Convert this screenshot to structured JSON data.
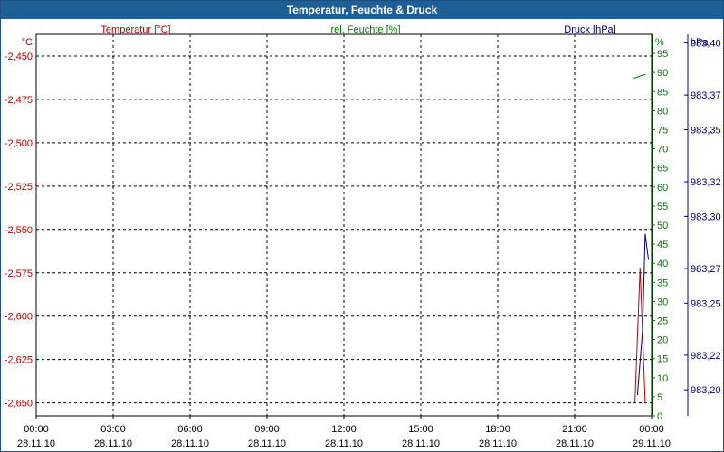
{
  "window": {
    "title": "Temperatur, Feuchte & Druck"
  },
  "chart_data": {
    "type": "line",
    "title": "Temperatur, Feuchte & Druck",
    "grid": true,
    "x_ticks": [
      {
        "time": "00:00",
        "date": "28.11.10"
      },
      {
        "time": "03:00",
        "date": "28.11.10"
      },
      {
        "time": "06:00",
        "date": "28.11.10"
      },
      {
        "time": "09:00",
        "date": "28.11.10"
      },
      {
        "time": "12:00",
        "date": "28.11.10"
      },
      {
        "time": "15:00",
        "date": "28.11.10"
      },
      {
        "time": "18:00",
        "date": "28.11.10"
      },
      {
        "time": "21:00",
        "date": "28.11.10"
      },
      {
        "time": "00:00",
        "date": "29.11.10"
      }
    ],
    "x_range_hours": [
      0,
      24
    ],
    "axes": {
      "temperature": {
        "label": "Temperatur [°C]",
        "unit": "°C",
        "color": "#c00000",
        "range": [
          -2.6575,
          -2.4375
        ],
        "ticks": [
          "-2,450",
          "-2,475",
          "-2,500",
          "-2,525",
          "-2,550",
          "-2,575",
          "-2,600",
          "-2,625",
          "-2,650"
        ]
      },
      "humidity": {
        "label": "rel. Feuchte [%]",
        "unit": "%",
        "color": "#007a00",
        "range": [
          0,
          100
        ],
        "ticks": [
          "0",
          "5",
          "10",
          "15",
          "20",
          "25",
          "30",
          "35",
          "40",
          "45",
          "50",
          "55",
          "60",
          "65",
          "70",
          "75",
          "80",
          "85",
          "90",
          "95"
        ]
      },
      "pressure": {
        "label": "Druck [hPa]",
        "unit": "hPa",
        "color": "#00007a",
        "range": [
          983.185,
          983.405
        ],
        "ticks": [
          "983,40",
          "983,37",
          "983,35",
          "983,32",
          "983,30",
          "983,27",
          "983,25",
          "983,22",
          "983,20"
        ]
      }
    },
    "series": [
      {
        "axis": "temperature",
        "color": "#c00000",
        "points": [
          [
            23.35,
            -2.65
          ],
          [
            23.55,
            -2.572
          ],
          [
            23.75,
            -2.65
          ]
        ]
      },
      {
        "axis": "humidity",
        "color": "#007a00",
        "points": [
          [
            23.3,
            88.5
          ],
          [
            23.75,
            89.5
          ]
        ]
      },
      {
        "axis": "pressure",
        "color": "#00007a",
        "points": [
          [
            23.45,
            983.197
          ],
          [
            23.65,
            983.235
          ],
          [
            23.75,
            983.29
          ],
          [
            23.88,
            983.275
          ]
        ]
      }
    ]
  }
}
